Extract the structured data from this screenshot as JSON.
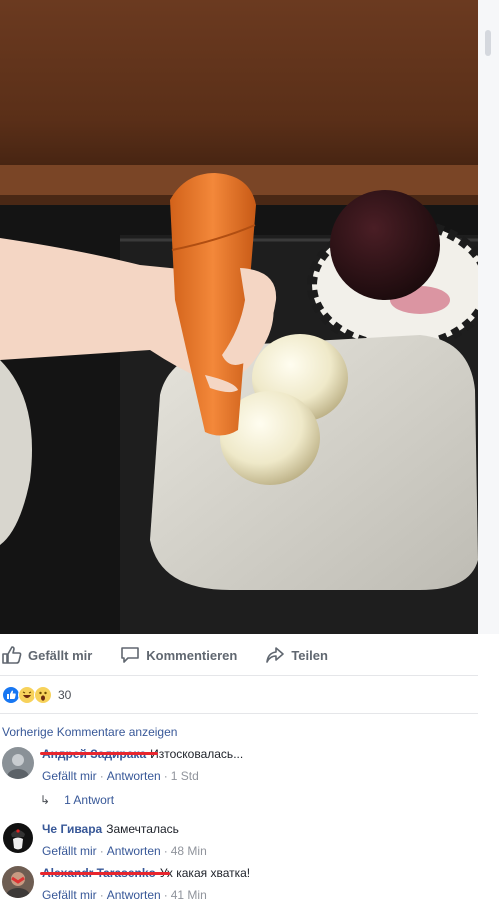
{
  "photo": {
    "alt": "post-photo"
  },
  "actions": {
    "like_label": "Gefällt mir",
    "comment_label": "Kommentieren",
    "share_label": "Teilen"
  },
  "reactions": {
    "icons": [
      "like-reaction-icon",
      "haha-reaction-icon",
      "wow-reaction-icon"
    ],
    "count": "30",
    "colors": {
      "like": "#1877f2",
      "emoji": "#f7d25b"
    }
  },
  "previous_comments_label": "Vorherige Kommentare anzeigen",
  "comments": [
    {
      "name": "Андрей Задирака",
      "name_struck": true,
      "text": "Изтосковалась...",
      "like_label": "Gefällt mir",
      "reply_label": "Antworten",
      "time": "1 Std",
      "replies_label": "1 Antwort"
    },
    {
      "name": "Че Гивара",
      "name_struck": false,
      "text": "Замечталась",
      "like_label": "Gefällt mir",
      "reply_label": "Antworten",
      "time": "48 Min"
    },
    {
      "name": "Alexandr Tarasenko",
      "name_struck": true,
      "text": "Ух какая хватка!",
      "like_label": "Gefällt mir",
      "reply_label": "Antworten",
      "time": "41 Min"
    }
  ],
  "colors": {
    "link": "#385898",
    "strike": "#e8262e",
    "meta": "#90949c"
  }
}
